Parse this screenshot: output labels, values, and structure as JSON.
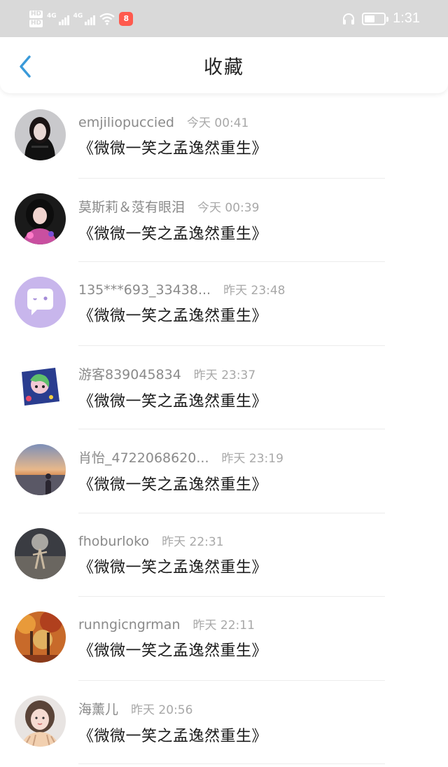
{
  "status_bar": {
    "hd_labels": [
      "HD",
      "HD"
    ],
    "signal_labels": [
      "4G",
      "4G"
    ],
    "app_badge": "8",
    "time": "1:31",
    "battery_percent": 55,
    "icons": [
      "headphone-icon",
      "battery-icon",
      "wifi-icon",
      "signal-icon"
    ]
  },
  "header": {
    "back_icon": "chevron-left-icon",
    "title": "收藏",
    "accent_color": "#3a9ad9"
  },
  "items": [
    {
      "username": "emjiliopuccied",
      "time": "今天 00:41",
      "book": "《微微一笑之孟逸然重生》",
      "avatar": "dark-portrait"
    },
    {
      "username": "莫斯莉＆莈有眼泪",
      "time": "今天 00:39",
      "book": "《微微一笑之孟逸然重生》",
      "avatar": "girl-portrait"
    },
    {
      "username": "135***693_33438...",
      "time": "昨天 23:48",
      "book": "《微微一笑之孟逸然重生》",
      "avatar": "default-chat"
    },
    {
      "username": "游客839045834",
      "time": "昨天 23:37",
      "book": "《微微一笑之孟逸然重生》",
      "avatar": "anime-sticker"
    },
    {
      "username": "肖怡_4722068620...",
      "time": "昨天 23:19",
      "book": "《微微一笑之孟逸然重生》",
      "avatar": "sunset-beach"
    },
    {
      "username": "fhoburloko",
      "time": "昨天 22:31",
      "book": "《微微一笑之孟逸然重生》",
      "avatar": "dark-field"
    },
    {
      "username": "runngicngrman",
      "time": "昨天 22:11",
      "book": "《微微一笑之孟逸然重生》",
      "avatar": "autumn-forest"
    },
    {
      "username": "海薰儿",
      "time": "昨天 20:56",
      "book": "《微微一笑之孟逸然重生》",
      "avatar": "girl-selfie"
    }
  ]
}
